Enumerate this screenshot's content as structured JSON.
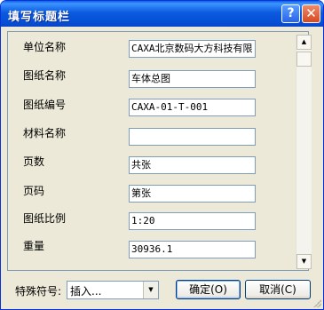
{
  "window": {
    "title": "填写标题栏",
    "help_glyph": "?",
    "close_glyph": "✕"
  },
  "fields": [
    {
      "label": "单位名称",
      "value": "CAXA北京数码大方科技有限"
    },
    {
      "label": "图纸名称",
      "value": "车体总图"
    },
    {
      "label": "图纸编号",
      "value": "CAXA-01-T-001"
    },
    {
      "label": "材料名称",
      "value": ""
    },
    {
      "label": "页数",
      "value": "共张"
    },
    {
      "label": "页码",
      "value": "第张"
    },
    {
      "label": "图纸比例",
      "value": "1:20"
    },
    {
      "label": "重量",
      "value": "30936.1"
    }
  ],
  "scrollbar": {
    "up_glyph": "▲",
    "down_glyph": "▼"
  },
  "footer": {
    "special_label": "特殊符号:",
    "special_value": "插入...",
    "dropdown_glyph": "▼",
    "ok_label": "确定(O)",
    "cancel_label": "取消(C)"
  },
  "colors": {
    "titlebar": "#0a5fe8",
    "dialog_bg": "#ece9d8",
    "close_button": "#d54a20"
  }
}
